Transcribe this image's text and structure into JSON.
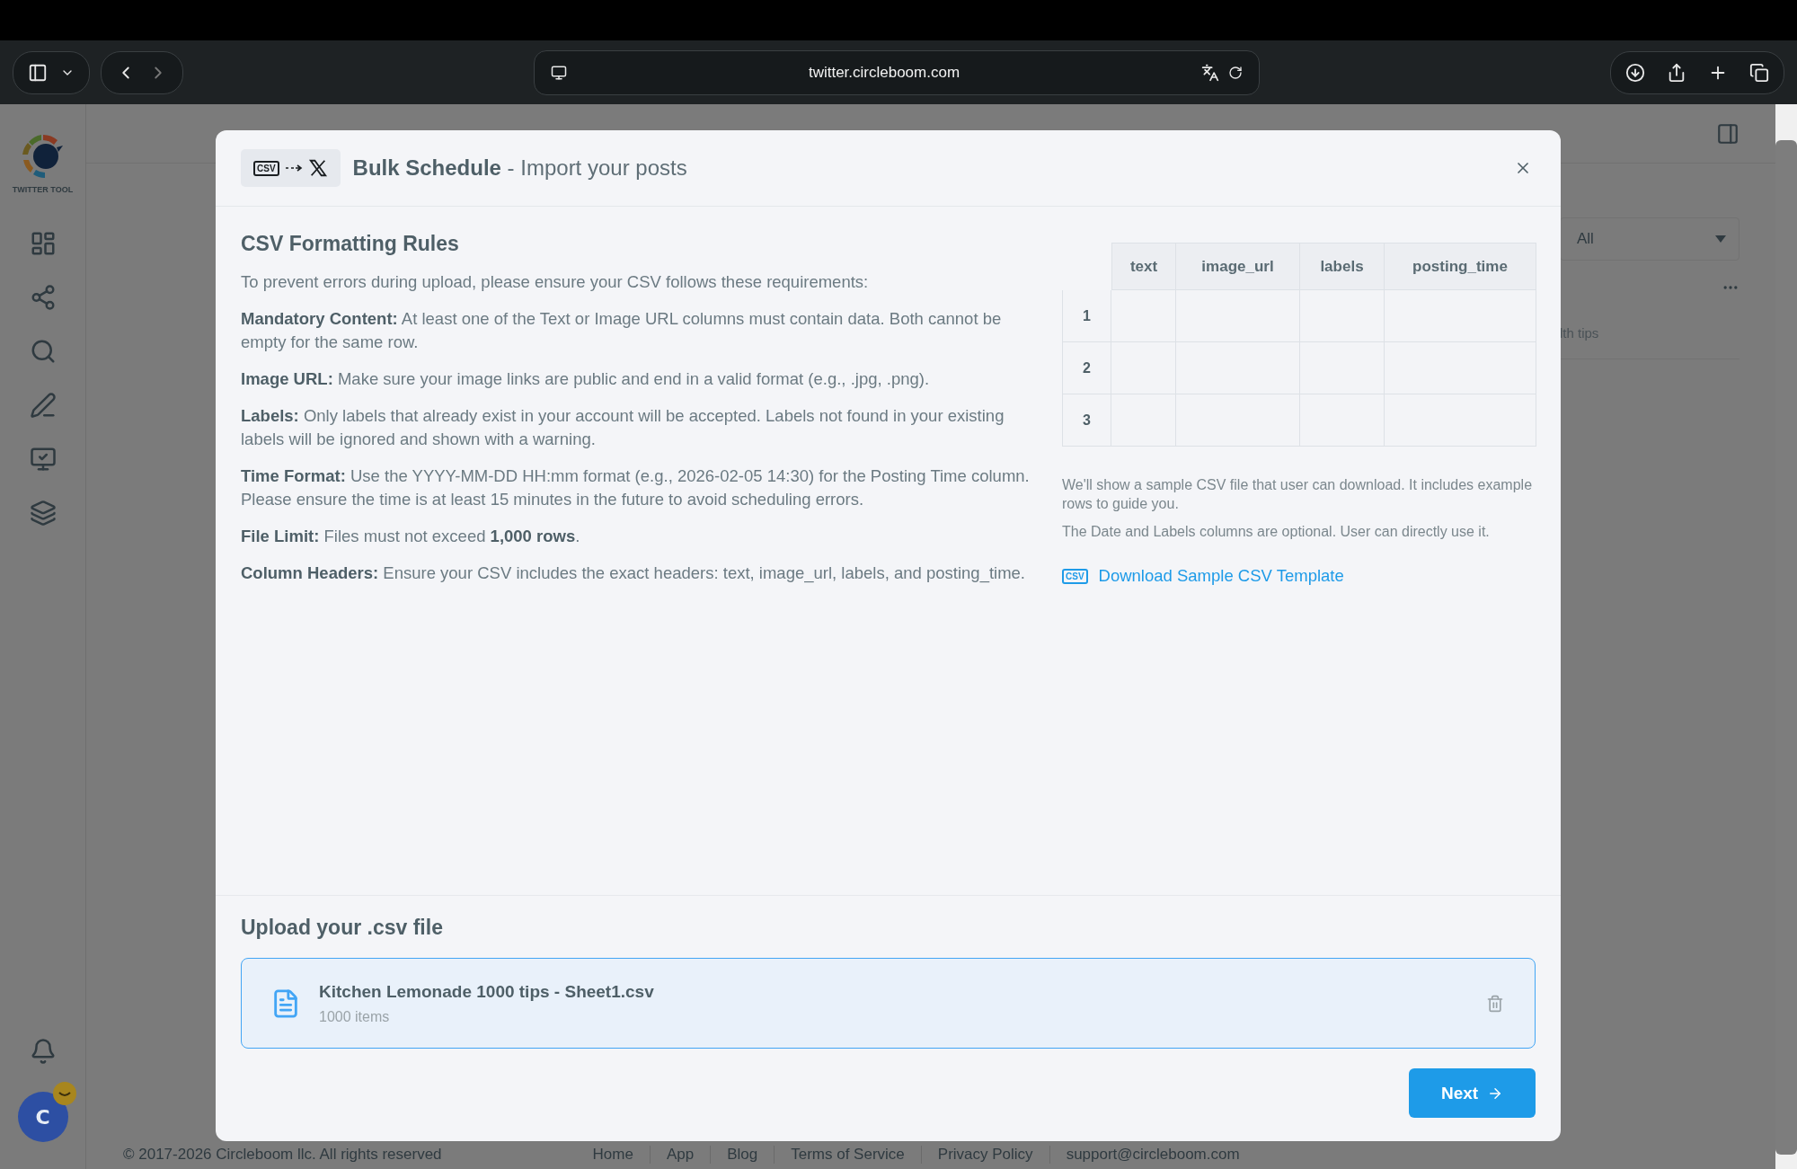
{
  "browser": {
    "url": "twitter.circleboom.com"
  },
  "sidebar": {
    "logo_caption": "TWITTER TOOL",
    "avatar_initial": "C"
  },
  "background": {
    "filter_select": "All",
    "card_text": "lth tips"
  },
  "modal": {
    "badge_text": "CSV",
    "title_bold": "Bulk Schedule",
    "title_rest": "- Import your posts",
    "rules": {
      "heading": "CSV Formatting Rules",
      "intro": "To prevent errors during upload, please ensure your CSV follows these requirements:",
      "items": [
        {
          "label": "Mandatory Content:",
          "text": "At least one of the Text or Image URL columns must contain data. Both cannot be empty for the same row."
        },
        {
          "label": "Image URL:",
          "text": "Make sure your image links are public and end in a valid format (e.g., .jpg, .png)."
        },
        {
          "label": "Labels:",
          "text": "Only labels that already exist in your account will be accepted. Labels not found in your existing labels will be ignored and shown with a warning."
        },
        {
          "label": "Time Format:",
          "text": "Use the YYYY-MM-DD HH:mm format (e.g., 2026-02-05 14:30) for the Posting Time column. Please ensure the time is at least 15 minutes in the future to avoid scheduling errors."
        },
        {
          "label": "File Limit:",
          "text": "Files must not exceed **1,000 rows**."
        },
        {
          "label": "Column Headers:",
          "text": "Ensure your CSV includes the exact headers: text, image_url, labels, and posting_time."
        }
      ]
    },
    "sample_table": {
      "columns": [
        "text",
        "image_url",
        "labels",
        "posting_time"
      ],
      "rows": [
        "1",
        "2",
        "3"
      ]
    },
    "notes": [
      "We'll show a sample CSV file that user can download. It includes example rows to guide you.",
      "The Date and Labels columns are optional. User can directly use it."
    ],
    "download_link": {
      "icon_text": "CSV",
      "label": "Download Sample CSV Template"
    },
    "upload": {
      "heading": "Upload your .csv file",
      "file": {
        "name": "Kitchen Lemonade 1000 tips - Sheet1.csv",
        "meta": "1000 items"
      }
    },
    "next_button": "Next"
  },
  "footer": {
    "copyright": "© 2017-2026 Circleboom llc. All rights reserved",
    "links": [
      "Home",
      "App",
      "Blog",
      "Terms of Service",
      "Privacy Policy",
      "support@circleboom.com"
    ]
  }
}
